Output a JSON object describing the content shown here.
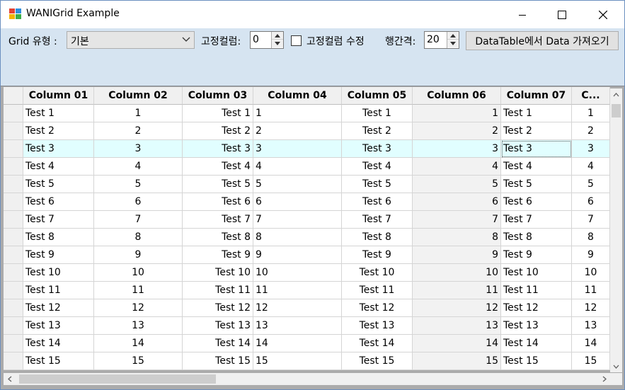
{
  "window": {
    "title": "WANIGrid Example",
    "icons": {
      "app": "app-icon",
      "minimize": "minimize-icon",
      "maximize": "maximize-icon",
      "close": "close-icon"
    }
  },
  "toolbar": {
    "grid_type_label": "Grid 유형 :",
    "grid_type_value": "기본",
    "fixed_col_label": "고정컬럼:",
    "fixed_col_value": "0",
    "fixed_edit_label": "고정컬럼 수정",
    "fixed_edit_checked": false,
    "row_gap_label": "행간격:",
    "row_gap_value": "20",
    "load_button": "DataTable에서 Data 가져오기"
  },
  "grid": {
    "columns": [
      "Column 01",
      "Column 02",
      "Column 03",
      "Column 04",
      "Column 05",
      "Column 06",
      "Column 07",
      "C..."
    ],
    "selected_row_index": 2,
    "rows": [
      [
        "Test 1",
        "1",
        "Test 1",
        "1",
        "Test 1",
        "1",
        "Test 1",
        "1"
      ],
      [
        "Test 2",
        "2",
        "Test 2",
        "2",
        "Test 2",
        "2",
        "Test 2",
        "2"
      ],
      [
        "Test 3",
        "3",
        "Test 3",
        "3",
        "Test 3",
        "3",
        "Test 3",
        "3"
      ],
      [
        "Test 4",
        "4",
        "Test 4",
        "4",
        "Test 4",
        "4",
        "Test 4",
        "4"
      ],
      [
        "Test 5",
        "5",
        "Test 5",
        "5",
        "Test 5",
        "5",
        "Test 5",
        "5"
      ],
      [
        "Test 6",
        "6",
        "Test 6",
        "6",
        "Test 6",
        "6",
        "Test 6",
        "6"
      ],
      [
        "Test 7",
        "7",
        "Test 7",
        "7",
        "Test 7",
        "7",
        "Test 7",
        "7"
      ],
      [
        "Test 8",
        "8",
        "Test 8",
        "8",
        "Test 8",
        "8",
        "Test 8",
        "8"
      ],
      [
        "Test 9",
        "9",
        "Test 9",
        "9",
        "Test 9",
        "9",
        "Test 9",
        "9"
      ],
      [
        "Test 10",
        "10",
        "Test 10",
        "10",
        "Test 10",
        "10",
        "Test 10",
        "10"
      ],
      [
        "Test 11",
        "11",
        "Test 11",
        "11",
        "Test 11",
        "11",
        "Test 11",
        "11"
      ],
      [
        "Test 12",
        "12",
        "Test 12",
        "12",
        "Test 12",
        "12",
        "Test 12",
        "12"
      ],
      [
        "Test 13",
        "13",
        "Test 13",
        "13",
        "Test 13",
        "13",
        "Test 13",
        "13"
      ],
      [
        "Test 14",
        "14",
        "Test 14",
        "14",
        "Test 14",
        "14",
        "Test 14",
        "14"
      ],
      [
        "Test 15",
        "15",
        "Test 15",
        "15",
        "Test 15",
        "15",
        "Test 15",
        "15"
      ]
    ]
  }
}
